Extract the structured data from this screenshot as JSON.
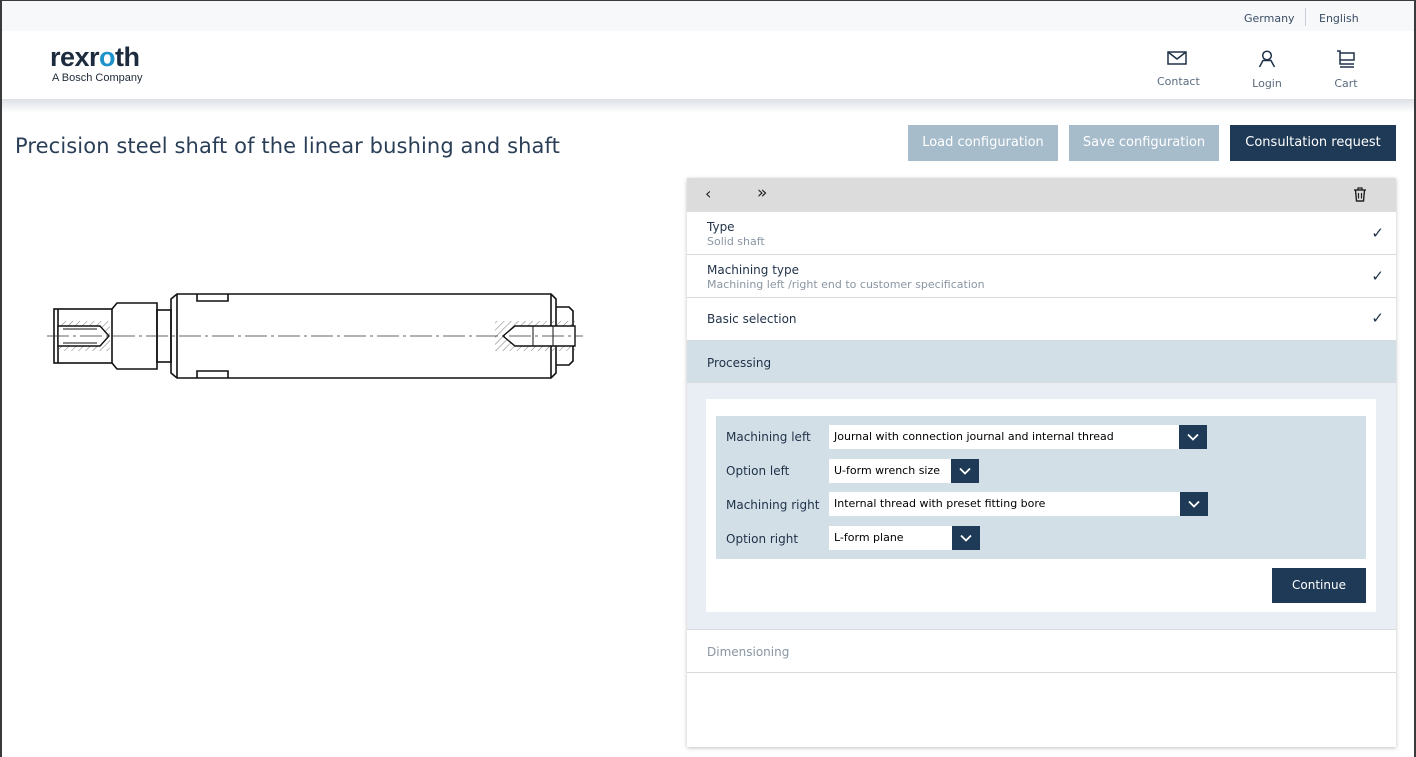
{
  "top_bar": {
    "country": "Germany",
    "language": "English"
  },
  "brand": {
    "logo_text_a": "rexr",
    "logo_text_b": "o",
    "logo_text_c": "th",
    "tagline": "A Bosch Company"
  },
  "header_nav": {
    "contact": {
      "label": "Contact",
      "icon": "envelope-icon"
    },
    "login": {
      "label": "Login",
      "icon": "user-icon"
    },
    "cart": {
      "label": "Cart",
      "icon": "cart-icon"
    }
  },
  "page": {
    "title": "Precision steel shaft of the linear bushing and shaft",
    "buttons": {
      "load": "Load configuration",
      "save": "Save configuration",
      "consultation": "Consultation request"
    }
  },
  "configurator": {
    "nav": {
      "prev": "‹",
      "forward": "»",
      "trash_icon": "trash-icon"
    },
    "steps": [
      {
        "title": "Type",
        "value": "Solid shaft",
        "done": "✓"
      },
      {
        "title": "Machining type",
        "value": "Machining left /right end to customer specification",
        "done": "✓"
      },
      {
        "title": "Basic selection",
        "value": "",
        "done": "✓"
      }
    ],
    "processing": {
      "title": "Processing",
      "fields": [
        {
          "label": "Machining left",
          "value": "Journal with connection journal and internal thread"
        },
        {
          "label": "Option left",
          "value": "U-form wrench size"
        },
        {
          "label": "Machining right",
          "value": "Internal thread with preset fitting bore"
        },
        {
          "label": "Option right",
          "value": "L-form plane"
        }
      ],
      "continue": "Continue"
    },
    "dimensioning": {
      "title": "Dimensioning"
    }
  },
  "colors": {
    "primary": "#1e3a56",
    "secondary_button": "#a6bccb",
    "active_step": "#d2dfe7",
    "brand_accent": "#1f92c9"
  }
}
